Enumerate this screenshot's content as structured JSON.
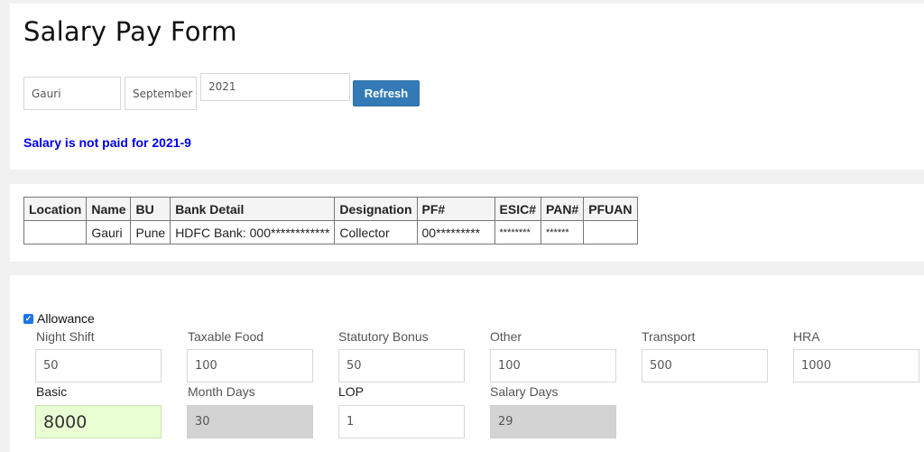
{
  "header": {
    "title": "Salary Pay Form"
  },
  "filters": {
    "name": "Gauri",
    "month": "September",
    "year": "2021",
    "refresh_label": "Refresh"
  },
  "status_message": "Salary is not paid for 2021-9",
  "employee_table": {
    "headers": [
      "Location",
      "Name",
      "BU",
      "Bank Detail",
      "Designation",
      "PF#",
      "ESIC#",
      "PAN#",
      "PFUAN"
    ],
    "row": [
      "",
      "Gauri",
      "Pune",
      "HDFC Bank: 000************",
      "Collector",
      "00*********",
      "********",
      "******",
      ""
    ]
  },
  "allowance": {
    "checkbox_label": "Allowance",
    "checked": true,
    "fields": [
      {
        "label": "Night Shift",
        "value": "50"
      },
      {
        "label": "Taxable Food",
        "value": "100"
      },
      {
        "label": "Statutory Bonus",
        "value": "50"
      },
      {
        "label": "Other",
        "value": "100"
      },
      {
        "label": "Transport",
        "value": "500"
      },
      {
        "label": "HRA",
        "value": "1000"
      },
      {
        "label": "Basic",
        "value": "8000"
      },
      {
        "label": "Month Days",
        "value": "30"
      },
      {
        "label": "LOP",
        "value": "1"
      },
      {
        "label": "Salary Days",
        "value": "29"
      }
    ]
  },
  "colors": {
    "accent": "#337ab7",
    "status": "#0000ee",
    "basic_bg": "#e9ffd4",
    "readonly_bg": "#d3d3d3"
  }
}
